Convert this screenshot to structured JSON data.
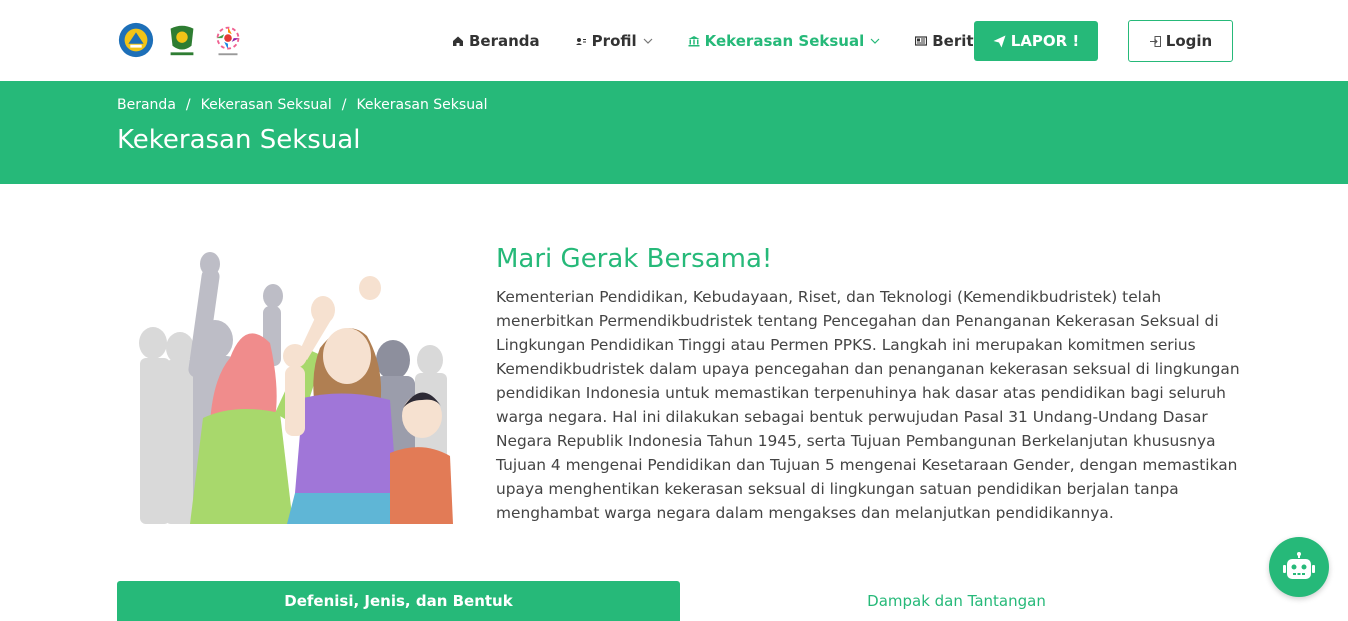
{
  "nav": {
    "items": [
      {
        "label": "Beranda",
        "icon": "home-icon"
      },
      {
        "label": "Profil",
        "icon": "user-card-icon"
      },
      {
        "label": "Kekerasan Seksual",
        "icon": "bank-icon",
        "active": true
      },
      {
        "label": "Berita",
        "icon": "newspaper-icon"
      }
    ],
    "lapor_label": "LAPOR !",
    "login_label": "Login"
  },
  "banner": {
    "breadcrumb": [
      "Beranda",
      "Kekerasan Seksual",
      "Kekerasan Seksual"
    ],
    "title": "Kekerasan Seksual"
  },
  "content": {
    "heading": "Mari Gerak Bersama!",
    "paragraph": "Kementerian Pendidikan, Kebudayaan, Riset, dan Teknologi (Kemendikbudristek) telah menerbitkan Permendikbudristek tentang Pencegahan dan Penanganan Kekerasan Seksual di Lingkungan Pendidikan Tinggi atau Permen PPKS. Langkah ini merupakan komitmen serius Kemendikbudristek dalam upaya pencegahan dan penanganan kekerasan seksual di lingkungan pendidikan Indonesia untuk memastikan terpenuhinya hak dasar atas pendidikan bagi seluruh warga negara. Hal ini dilakukan sebagai bentuk perwujudan Pasal 31 Undang-Undang Dasar Negara Republik Indonesia Tahun 1945, serta Tujuan Pembangunan Berkelanjutan khususnya Tujuan 4 mengenai Pendidikan dan Tujuan 5 mengenai Kesetaraan Gender, dengan memastikan upaya menghentikan kekerasan seksual di lingkungan satuan pendidikan berjalan tanpa menghambat warga negara dalam mengakses dan melanjutkan pendidikannya."
  },
  "tabs": [
    {
      "label": "Defenisi, Jenis, dan Bentuk",
      "active": true
    },
    {
      "label": "Dampak dan Tantangan",
      "active": false
    }
  ],
  "colors": {
    "accent": "#26b979"
  }
}
